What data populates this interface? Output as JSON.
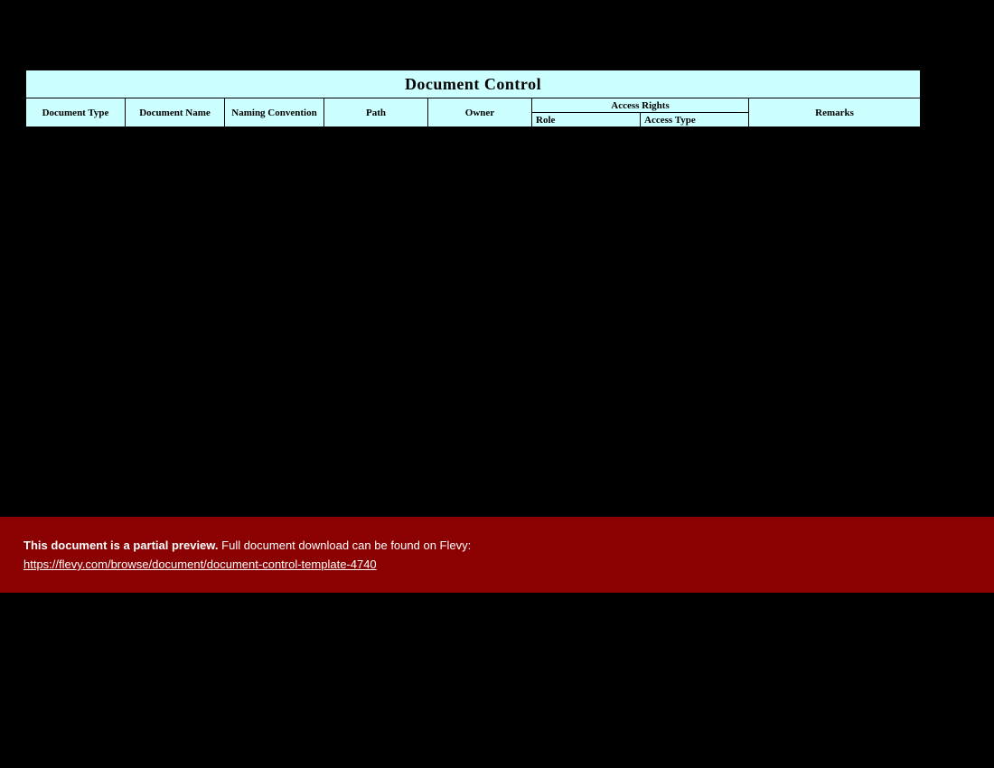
{
  "table": {
    "title": "Document Control",
    "headers": {
      "document_type": "Document Type",
      "document_name": "Document Name",
      "naming_convention": "Naming Convention",
      "path": "Path",
      "owner": "Owner",
      "access_rights": "Access Rights",
      "role": "Role",
      "access_type": "Access Type",
      "remarks": "Remarks"
    }
  },
  "banner": {
    "bold_text": "This document is a partial preview.",
    "rest_text": "  Full document download can be found on Flevy:",
    "link_text": "https://flevy.com/browse/document/document-control-template-4740"
  }
}
